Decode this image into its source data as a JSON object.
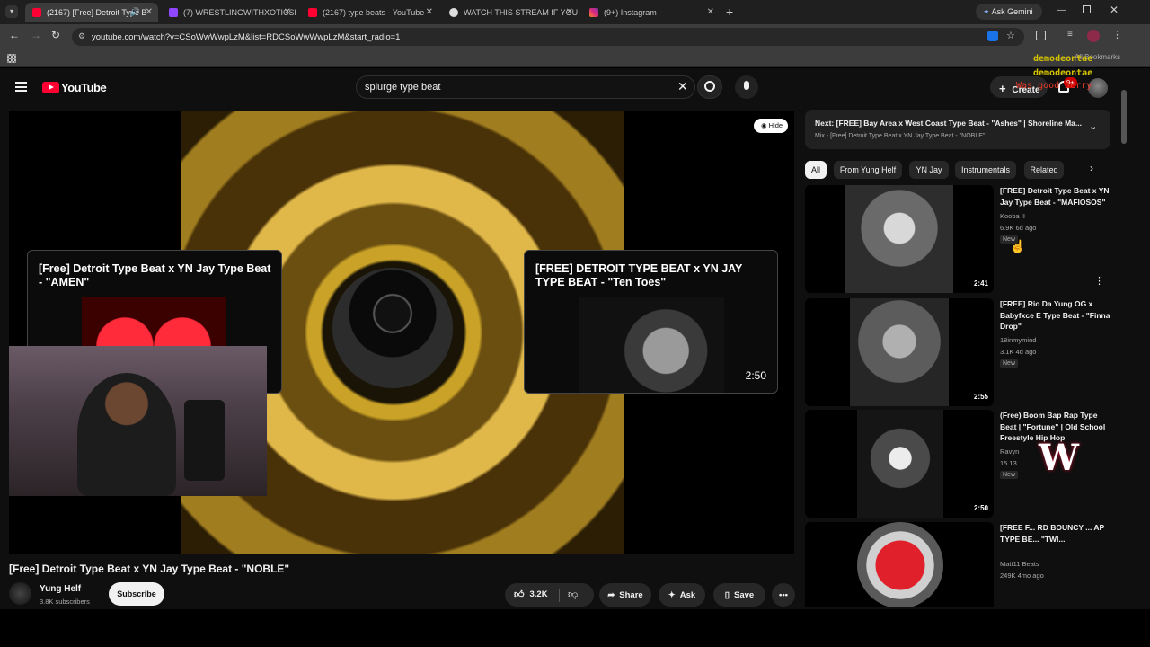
{
  "browser": {
    "tabs": [
      {
        "title": "(2167) [Free] Detroit Type B",
        "active": true
      },
      {
        "title": "(7) WRESTLINGWITHXOTICSLIV",
        "active": false
      },
      {
        "title": "(2167) type beats - YouTube",
        "active": false
      },
      {
        "title": "WATCH THIS STREAM IF YOU A",
        "active": false
      },
      {
        "title": "(9+) Instagram",
        "active": false
      }
    ],
    "ask_gemini": "Ask Gemini",
    "url": "youtube.com/watch?v=CSoWwWwpLzM&list=RDCSoWwWwpLzM&start_radio=1",
    "bookmarks_label": "All Bookmarks"
  },
  "youtube": {
    "logo_text": "YouTube",
    "search_value": "splurge type beat",
    "create_label": "Create",
    "notification_badge": "9+",
    "overlay_chat": {
      "username": "demodeontae",
      "message": "Was good Jerry"
    },
    "player": {
      "hide_label": "Hide",
      "endcard_left": {
        "title": "[Free] Detroit Type Beat x YN Jay Type Beat - \"AMEN\""
      },
      "endcard_right": {
        "title": "[FREE] DETROIT TYPE BEAT x YN JAY TYPE BEAT - \"Ten Toes\"",
        "duration": "2:50"
      }
    },
    "video": {
      "title": "[Free] Detroit Type Beat x YN Jay Type Beat - \"NOBLE\"",
      "channel": "Yung Helf",
      "subscribers": "3.8K subscribers",
      "subscribe_label": "Subscribe",
      "likes": "3.2K",
      "share_label": "Share",
      "ask_label": "Ask",
      "save_label": "Save"
    },
    "up_next": {
      "title": "Next: [FREE] Bay Area x West Coast Type Beat - \"Ashes\" | Shoreline Ma...",
      "subtitle": "Mix - [Free] Detroit Type Beat x YN Jay Type Beat - \"NOBLE\""
    },
    "chips": [
      "All",
      "From Yung Helf",
      "YN Jay",
      "Instrumentals",
      "Related"
    ],
    "recommendations": [
      {
        "title": "[FREE] Detroit Type Beat x YN Jay Type Beat - \"MAFIOSOS\"",
        "channel": "Kooba II",
        "meta": "6.9K  6d ago",
        "badge": "New",
        "duration": "2:41"
      },
      {
        "title": "[FREE] Rio Da Yung OG x Babyfxce E Type Beat - \"Finna Drop\"",
        "channel": "18inmymind",
        "meta": "3.1K  4d ago",
        "badge": "New",
        "duration": "2:55"
      },
      {
        "title": "(Free) Boom Bap Rap Type Beat | \"Fortune\" | Old School Freestyle Hip Hop",
        "channel": "Ravyn",
        "meta": "15  13",
        "badge": "New",
        "duration": "2:50"
      },
      {
        "title": "[FREE F... RD BOUNCY ... AP TYPE BE... \"TWI...",
        "channel": "Matt11 Beats",
        "meta": "249K  4mo ago",
        "badge": "",
        "duration": ""
      }
    ]
  },
  "colors": {
    "brand_red": "#ff0033",
    "bg": "#0f0f0f",
    "gold": "#c9a227",
    "accent_blue": "#3ea6ff"
  }
}
